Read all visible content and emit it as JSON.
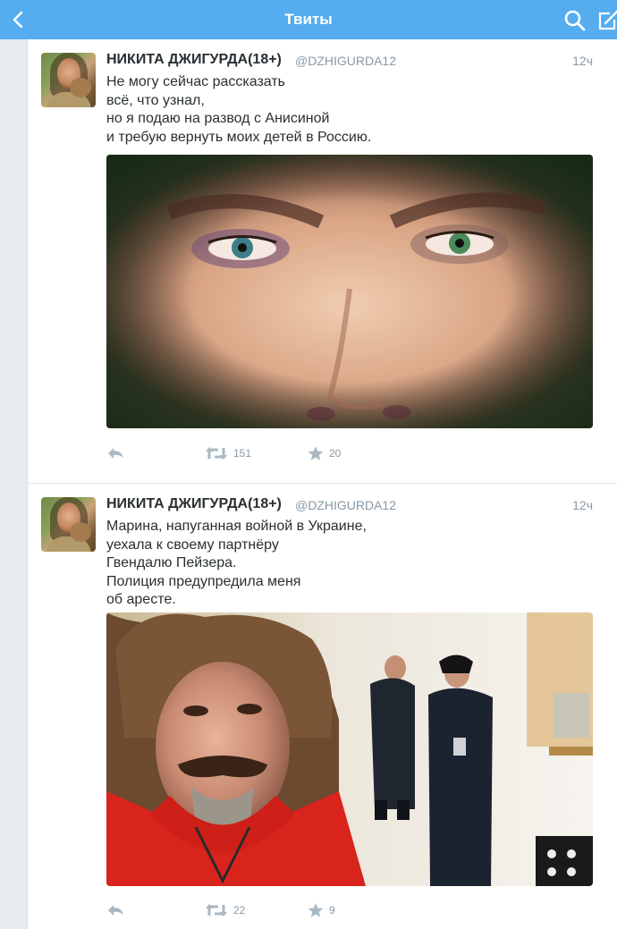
{
  "nav": {
    "title": "Твиты",
    "back_icon": "back-chevron-icon",
    "search_icon": "search-icon",
    "compose_icon": "compose-icon",
    "bar_color": "#55acee"
  },
  "tweets": [
    {
      "author": "НИКИТА ДЖИГУРДА(18+)",
      "handle": "@DZHIGURDA12",
      "time": "12ч",
      "lines": [
        "Не могу сейчас рассказать",
        "всё, что узнал,",
        "но я подаю на развод с Анисиной",
        "и требую вернуть моих детей в Россию."
      ],
      "retweets": "151",
      "favorites": "20"
    },
    {
      "author": "НИКИТА ДЖИГУРДА(18+)",
      "handle": "@DZHIGURDA12",
      "time": "12ч",
      "lines": [
        "Марина, напуганная войной в Украине,",
        "уехала к своему партнёру",
        "Гвендалю Пейзера.",
        "Полиция предупредила меня",
        "об аресте."
      ],
      "retweets": "22",
      "favorites": "9"
    }
  ]
}
